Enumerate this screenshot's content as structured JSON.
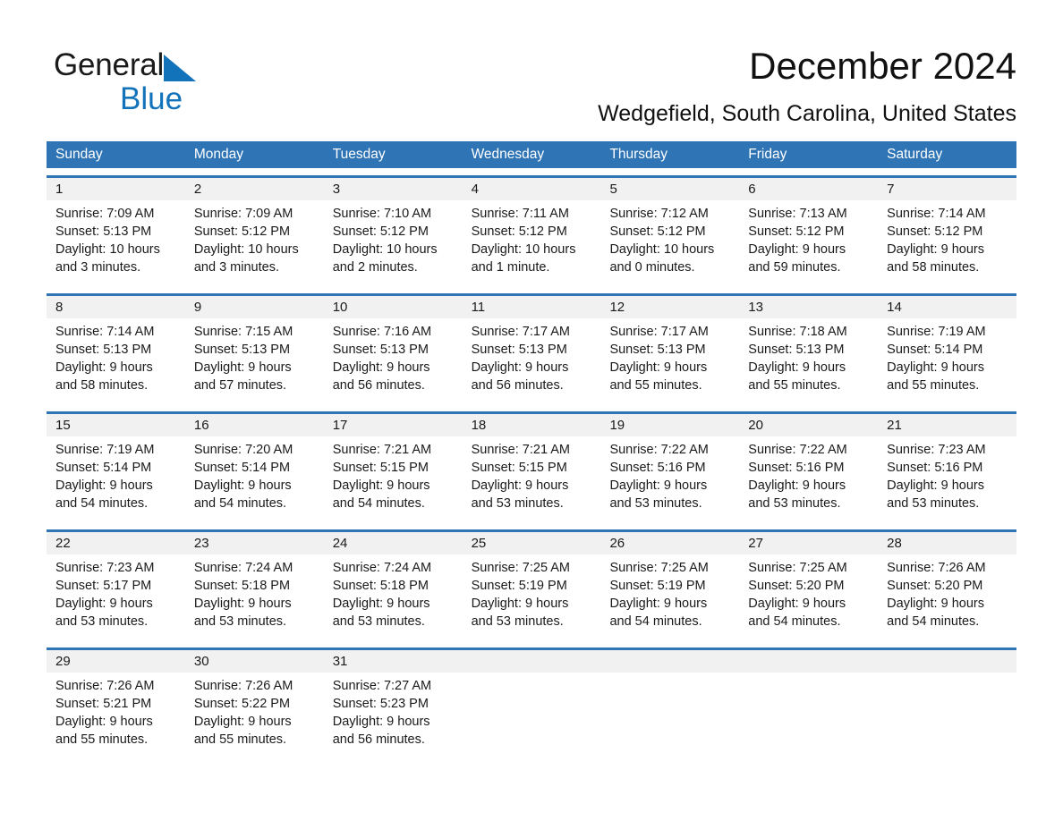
{
  "brand": {
    "name_part1": "General",
    "name_part2": "Blue",
    "triangle_color": "#1273bb",
    "text_color_1": "#1a1a1a",
    "text_color_2": "#1273bb"
  },
  "header": {
    "title": "December 2024",
    "subtitle": "Wedgefield, South Carolina, United States"
  },
  "theme": {
    "header_blue": "#2f74b5",
    "daynum_band": "#f1f1f1",
    "text": "#1a1a1a",
    "page_bg": "#ffffff"
  },
  "weekdays": [
    "Sunday",
    "Monday",
    "Tuesday",
    "Wednesday",
    "Thursday",
    "Friday",
    "Saturday"
  ],
  "weeks": [
    {
      "days": [
        {
          "num": "1",
          "l1": "Sunrise: 7:09 AM",
          "l2": "Sunset: 5:13 PM",
          "l3": "Daylight: 10 hours",
          "l4": "and 3 minutes."
        },
        {
          "num": "2",
          "l1": "Sunrise: 7:09 AM",
          "l2": "Sunset: 5:12 PM",
          "l3": "Daylight: 10 hours",
          "l4": "and 3 minutes."
        },
        {
          "num": "3",
          "l1": "Sunrise: 7:10 AM",
          "l2": "Sunset: 5:12 PM",
          "l3": "Daylight: 10 hours",
          "l4": "and 2 minutes."
        },
        {
          "num": "4",
          "l1": "Sunrise: 7:11 AM",
          "l2": "Sunset: 5:12 PM",
          "l3": "Daylight: 10 hours",
          "l4": "and 1 minute."
        },
        {
          "num": "5",
          "l1": "Sunrise: 7:12 AM",
          "l2": "Sunset: 5:12 PM",
          "l3": "Daylight: 10 hours",
          "l4": "and 0 minutes."
        },
        {
          "num": "6",
          "l1": "Sunrise: 7:13 AM",
          "l2": "Sunset: 5:12 PM",
          "l3": "Daylight: 9 hours",
          "l4": "and 59 minutes."
        },
        {
          "num": "7",
          "l1": "Sunrise: 7:14 AM",
          "l2": "Sunset: 5:12 PM",
          "l3": "Daylight: 9 hours",
          "l4": "and 58 minutes."
        }
      ]
    },
    {
      "days": [
        {
          "num": "8",
          "l1": "Sunrise: 7:14 AM",
          "l2": "Sunset: 5:13 PM",
          "l3": "Daylight: 9 hours",
          "l4": "and 58 minutes."
        },
        {
          "num": "9",
          "l1": "Sunrise: 7:15 AM",
          "l2": "Sunset: 5:13 PM",
          "l3": "Daylight: 9 hours",
          "l4": "and 57 minutes."
        },
        {
          "num": "10",
          "l1": "Sunrise: 7:16 AM",
          "l2": "Sunset: 5:13 PM",
          "l3": "Daylight: 9 hours",
          "l4": "and 56 minutes."
        },
        {
          "num": "11",
          "l1": "Sunrise: 7:17 AM",
          "l2": "Sunset: 5:13 PM",
          "l3": "Daylight: 9 hours",
          "l4": "and 56 minutes."
        },
        {
          "num": "12",
          "l1": "Sunrise: 7:17 AM",
          "l2": "Sunset: 5:13 PM",
          "l3": "Daylight: 9 hours",
          "l4": "and 55 minutes."
        },
        {
          "num": "13",
          "l1": "Sunrise: 7:18 AM",
          "l2": "Sunset: 5:13 PM",
          "l3": "Daylight: 9 hours",
          "l4": "and 55 minutes."
        },
        {
          "num": "14",
          "l1": "Sunrise: 7:19 AM",
          "l2": "Sunset: 5:14 PM",
          "l3": "Daylight: 9 hours",
          "l4": "and 55 minutes."
        }
      ]
    },
    {
      "days": [
        {
          "num": "15",
          "l1": "Sunrise: 7:19 AM",
          "l2": "Sunset: 5:14 PM",
          "l3": "Daylight: 9 hours",
          "l4": "and 54 minutes."
        },
        {
          "num": "16",
          "l1": "Sunrise: 7:20 AM",
          "l2": "Sunset: 5:14 PM",
          "l3": "Daylight: 9 hours",
          "l4": "and 54 minutes."
        },
        {
          "num": "17",
          "l1": "Sunrise: 7:21 AM",
          "l2": "Sunset: 5:15 PM",
          "l3": "Daylight: 9 hours",
          "l4": "and 54 minutes."
        },
        {
          "num": "18",
          "l1": "Sunrise: 7:21 AM",
          "l2": "Sunset: 5:15 PM",
          "l3": "Daylight: 9 hours",
          "l4": "and 53 minutes."
        },
        {
          "num": "19",
          "l1": "Sunrise: 7:22 AM",
          "l2": "Sunset: 5:16 PM",
          "l3": "Daylight: 9 hours",
          "l4": "and 53 minutes."
        },
        {
          "num": "20",
          "l1": "Sunrise: 7:22 AM",
          "l2": "Sunset: 5:16 PM",
          "l3": "Daylight: 9 hours",
          "l4": "and 53 minutes."
        },
        {
          "num": "21",
          "l1": "Sunrise: 7:23 AM",
          "l2": "Sunset: 5:16 PM",
          "l3": "Daylight: 9 hours",
          "l4": "and 53 minutes."
        }
      ]
    },
    {
      "days": [
        {
          "num": "22",
          "l1": "Sunrise: 7:23 AM",
          "l2": "Sunset: 5:17 PM",
          "l3": "Daylight: 9 hours",
          "l4": "and 53 minutes."
        },
        {
          "num": "23",
          "l1": "Sunrise: 7:24 AM",
          "l2": "Sunset: 5:18 PM",
          "l3": "Daylight: 9 hours",
          "l4": "and 53 minutes."
        },
        {
          "num": "24",
          "l1": "Sunrise: 7:24 AM",
          "l2": "Sunset: 5:18 PM",
          "l3": "Daylight: 9 hours",
          "l4": "and 53 minutes."
        },
        {
          "num": "25",
          "l1": "Sunrise: 7:25 AM",
          "l2": "Sunset: 5:19 PM",
          "l3": "Daylight: 9 hours",
          "l4": "and 53 minutes."
        },
        {
          "num": "26",
          "l1": "Sunrise: 7:25 AM",
          "l2": "Sunset: 5:19 PM",
          "l3": "Daylight: 9 hours",
          "l4": "and 54 minutes."
        },
        {
          "num": "27",
          "l1": "Sunrise: 7:25 AM",
          "l2": "Sunset: 5:20 PM",
          "l3": "Daylight: 9 hours",
          "l4": "and 54 minutes."
        },
        {
          "num": "28",
          "l1": "Sunrise: 7:26 AM",
          "l2": "Sunset: 5:20 PM",
          "l3": "Daylight: 9 hours",
          "l4": "and 54 minutes."
        }
      ]
    },
    {
      "days": [
        {
          "num": "29",
          "l1": "Sunrise: 7:26 AM",
          "l2": "Sunset: 5:21 PM",
          "l3": "Daylight: 9 hours",
          "l4": "and 55 minutes."
        },
        {
          "num": "30",
          "l1": "Sunrise: 7:26 AM",
          "l2": "Sunset: 5:22 PM",
          "l3": "Daylight: 9 hours",
          "l4": "and 55 minutes."
        },
        {
          "num": "31",
          "l1": "Sunrise: 7:27 AM",
          "l2": "Sunset: 5:23 PM",
          "l3": "Daylight: 9 hours",
          "l4": "and 56 minutes."
        },
        {
          "num": "",
          "l1": "",
          "l2": "",
          "l3": "",
          "l4": ""
        },
        {
          "num": "",
          "l1": "",
          "l2": "",
          "l3": "",
          "l4": ""
        },
        {
          "num": "",
          "l1": "",
          "l2": "",
          "l3": "",
          "l4": ""
        },
        {
          "num": "",
          "l1": "",
          "l2": "",
          "l3": "",
          "l4": ""
        }
      ]
    }
  ]
}
